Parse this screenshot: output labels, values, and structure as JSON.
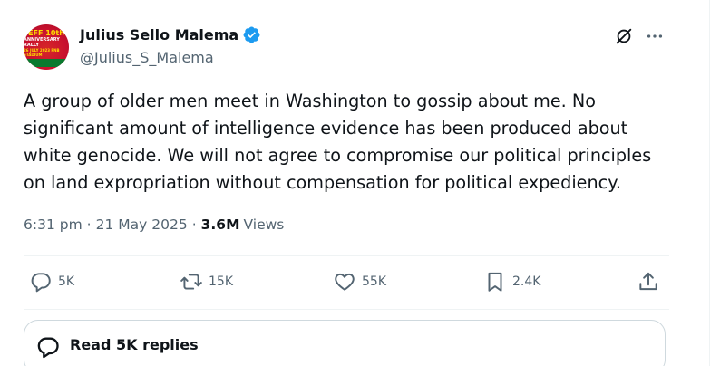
{
  "author": {
    "display_name": "Julius Sello Malema",
    "handle": "@Julius_S_Malema",
    "verified": true,
    "avatar": {
      "line1": "EFF 10th",
      "line2": "ANNIVERSARY RALLY",
      "line3": "26 JULY 2023 FNB STADIUM"
    }
  },
  "tweet": {
    "text": "A group of older men meet in Washington to gossip about me. No significant amount of intelligence evidence has been produced about white genocide. We will not agree to compromise our political principles on land expropriation without compensation for political expediency.",
    "time": "6:31 pm",
    "date": "21 May 2025",
    "views_count": "3.6M",
    "views_label": "Views"
  },
  "actions": {
    "replies": "5K",
    "reposts": "15K",
    "likes": "55K",
    "bookmarks": "2.4K"
  },
  "replies_button": {
    "label": "Read 5K replies"
  },
  "icons": {
    "verified": "verified-badge-icon",
    "grok": "grok-icon",
    "more": "more-icon",
    "reply": "reply-icon",
    "repost": "repost-icon",
    "like": "heart-icon",
    "bookmark": "bookmark-icon",
    "share": "share-icon",
    "replies_bubble": "speech-bubble-icon"
  },
  "colors": {
    "text_primary": "#0f1419",
    "text_secondary": "#536471",
    "verified_blue": "#1d9bf0",
    "border": "#cfd9de",
    "divider": "#eff3f4"
  }
}
